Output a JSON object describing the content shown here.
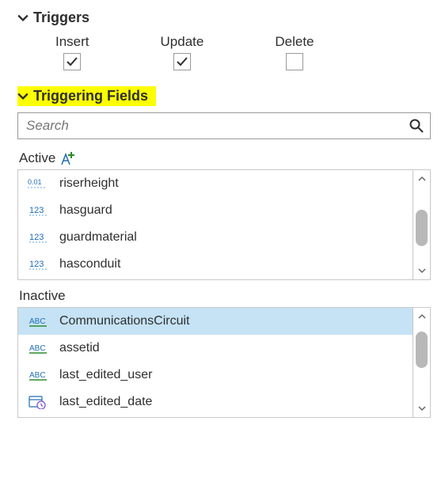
{
  "sections": {
    "triggers": {
      "title": "Triggers"
    },
    "triggering_fields": {
      "title": "Triggering Fields"
    }
  },
  "triggers": {
    "insert": {
      "label": "Insert",
      "checked": true
    },
    "update": {
      "label": "Update",
      "checked": true
    },
    "delete": {
      "label": "Delete",
      "checked": false
    }
  },
  "search": {
    "placeholder": "Search"
  },
  "active": {
    "label": "Active",
    "items": [
      {
        "name": "riserheight",
        "type": "decimal"
      },
      {
        "name": "hasguard",
        "type": "integer"
      },
      {
        "name": "guardmaterial",
        "type": "integer"
      },
      {
        "name": "hasconduit",
        "type": "integer"
      }
    ]
  },
  "inactive": {
    "label": "Inactive",
    "items": [
      {
        "name": "CommunicationsCircuit",
        "type": "text",
        "selected": true
      },
      {
        "name": "assetid",
        "type": "text"
      },
      {
        "name": "last_edited_user",
        "type": "text"
      },
      {
        "name": "last_edited_date",
        "type": "date"
      }
    ]
  }
}
